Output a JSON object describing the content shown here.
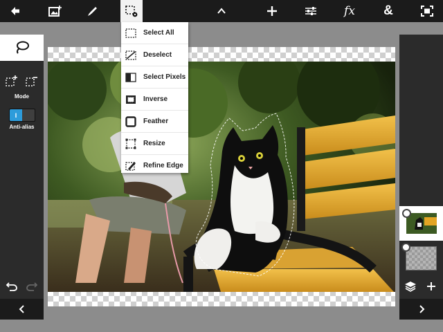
{
  "toolbar": {
    "buttons": [
      "back",
      "add-image",
      "brush",
      "selection-tools",
      "collapse",
      "add",
      "adjustments",
      "effects",
      "blend",
      "fullscreen"
    ],
    "fx_label": "fx",
    "amp_label": "&"
  },
  "selection_menu": {
    "items": [
      {
        "label": "Select All",
        "icon": "select-all-icon"
      },
      {
        "label": "Deselect",
        "icon": "deselect-icon"
      },
      {
        "label": "Select Pixels",
        "icon": "select-pixels-icon"
      },
      {
        "label": "Inverse",
        "icon": "inverse-icon"
      },
      {
        "label": "Feather",
        "icon": "feather-icon"
      },
      {
        "label": "Resize",
        "icon": "resize-icon"
      },
      {
        "label": "Refine Edge",
        "icon": "refine-edge-icon"
      }
    ]
  },
  "left_panel": {
    "mode_label": "Mode",
    "antialias_label": "Anti-alias",
    "antialias_on_label": "I",
    "antialias_enabled": true
  },
  "colors": {
    "toolbar_bg": "#1b1b1b",
    "panel_bg": "#2b2b2b",
    "workspace_bg": "#8c8c8c",
    "accent": "#2d9cdb",
    "bench_yellow": "#e3a524"
  }
}
